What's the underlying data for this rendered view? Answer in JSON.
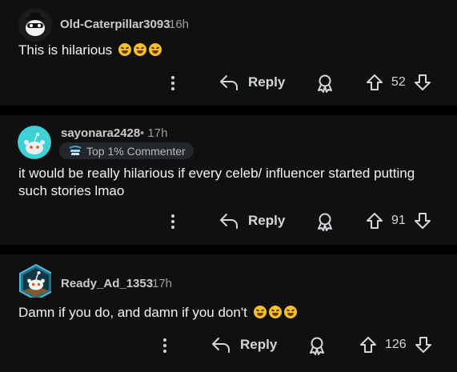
{
  "comments": [
    {
      "username": "Old-Caterpillar3093",
      "time": "16h",
      "text": "This is hilarious",
      "emoji_count": 3,
      "reply_label": "Reply",
      "votes": "52"
    },
    {
      "username": "sayonara2428",
      "time": "• 17h",
      "badge": "Top 1% Commenter",
      "text": "it would be really hilarious if every celeb/ influencer started putting such stories lmao",
      "reply_label": "Reply",
      "votes": "91"
    },
    {
      "username": "Ready_Ad_1353",
      "time": "17h",
      "text": "Damn if you do, and damn if you don't",
      "emoji_count": 3,
      "reply_label": "Reply",
      "votes": "126"
    }
  ],
  "colors": {
    "background": "#101010",
    "separator": "#000000",
    "text": "#f1f3f4",
    "muted": "#9a9ea1",
    "badge_bg": "#23262a",
    "avatar_teal": "#3fd1d6"
  },
  "icons": [
    "more-vertical-icon",
    "reply-arrow-icon",
    "award-icon",
    "upvote-icon",
    "downvote-icon",
    "badge-icon",
    "emoji-rofl-icon"
  ]
}
